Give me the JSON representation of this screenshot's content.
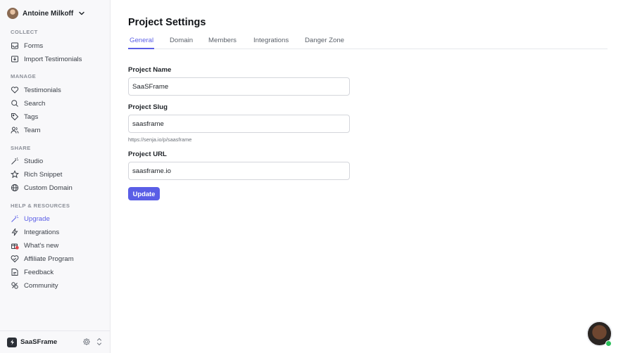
{
  "user": {
    "name": "Antoine Milkoff"
  },
  "sidebar": {
    "sections": [
      {
        "title": "COLLECT",
        "items": [
          {
            "label": "Forms",
            "icon": "inbox-icon"
          },
          {
            "label": "Import Testimonials",
            "icon": "import-icon"
          }
        ]
      },
      {
        "title": "MANAGE",
        "items": [
          {
            "label": "Testimonials",
            "icon": "heart-icon"
          },
          {
            "label": "Search",
            "icon": "search-icon"
          },
          {
            "label": "Tags",
            "icon": "tag-icon"
          },
          {
            "label": "Team",
            "icon": "users-icon"
          }
        ]
      },
      {
        "title": "SHARE",
        "items": [
          {
            "label": "Studio",
            "icon": "magic-wand-icon"
          },
          {
            "label": "Rich Snippet",
            "icon": "star-icon"
          },
          {
            "label": "Custom Domain",
            "icon": "globe-icon"
          }
        ]
      },
      {
        "title": "HELP & RESOURCES",
        "items": [
          {
            "label": "Upgrade",
            "icon": "sparkle-icon",
            "active": true
          },
          {
            "label": "Integrations",
            "icon": "lightning-icon"
          },
          {
            "label": "What's new",
            "icon": "gift-icon"
          },
          {
            "label": "Affiliate Program",
            "icon": "heart-handshake-icon"
          },
          {
            "label": "Feedback",
            "icon": "feedback-icon"
          },
          {
            "label": "Community",
            "icon": "community-icon"
          }
        ]
      }
    ]
  },
  "footer": {
    "project_name": "SaaSFrame"
  },
  "page": {
    "title": "Project Settings",
    "tabs": [
      {
        "label": "General",
        "active": true
      },
      {
        "label": "Domain"
      },
      {
        "label": "Members"
      },
      {
        "label": "Integrations"
      },
      {
        "label": "Danger Zone"
      }
    ]
  },
  "form": {
    "project_name": {
      "label": "Project Name",
      "value": "SaaSFrame"
    },
    "project_slug": {
      "label": "Project Slug",
      "value": "saasframe",
      "hint": "https://senja.io/p/saasframe"
    },
    "project_url": {
      "label": "Project URL",
      "value": "saasframe.io"
    },
    "submit_label": "Update"
  },
  "colors": {
    "accent": "#5a5ee6",
    "sidebar_bg": "#f8f8fa",
    "online": "#2bbf5a"
  }
}
